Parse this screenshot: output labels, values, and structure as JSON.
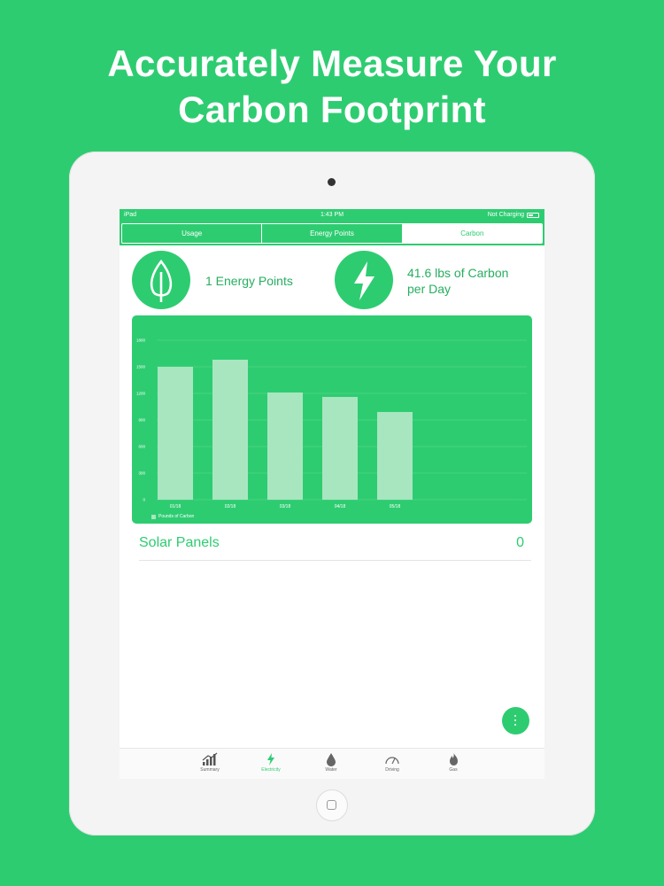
{
  "headline": {
    "line1": "Accurately Measure Your",
    "line2": "Carbon Footprint"
  },
  "status": {
    "device": "iPad",
    "time": "1:43 PM",
    "charging": "Not Charging"
  },
  "segments": [
    {
      "label": "Usage",
      "active": false
    },
    {
      "label": "Energy Points",
      "active": false
    },
    {
      "label": "Carbon",
      "active": true
    }
  ],
  "stats": {
    "energy_points": "1 Energy Points",
    "carbon_line1": "41.6 lbs of Carbon",
    "carbon_line2": "per Day"
  },
  "chart_data": {
    "type": "bar",
    "categories": [
      "01/18",
      "02/18",
      "03/18",
      "04/18",
      "05/18"
    ],
    "values": [
      1500,
      1580,
      1210,
      1160,
      990
    ],
    "yticks": [
      0,
      300,
      600,
      900,
      1200,
      1500,
      1800
    ],
    "ylim": [
      0,
      1800
    ],
    "legend": "Pounds of Carbon",
    "colors": {
      "background": "#2ecc71",
      "bar": "#a8e6c0",
      "grid": "#5dd990"
    }
  },
  "solar": {
    "label": "Solar Panels",
    "value": "0"
  },
  "tabs": [
    {
      "label": "Summary",
      "icon": "chart-icon",
      "active": false
    },
    {
      "label": "Electricity",
      "icon": "bolt-icon",
      "active": true
    },
    {
      "label": "Water",
      "icon": "drop-icon",
      "active": false
    },
    {
      "label": "Driving",
      "icon": "speedometer-icon",
      "active": false
    },
    {
      "label": "Gas",
      "icon": "flame-icon",
      "active": false
    }
  ],
  "colors": {
    "accent": "#2ecc71"
  }
}
